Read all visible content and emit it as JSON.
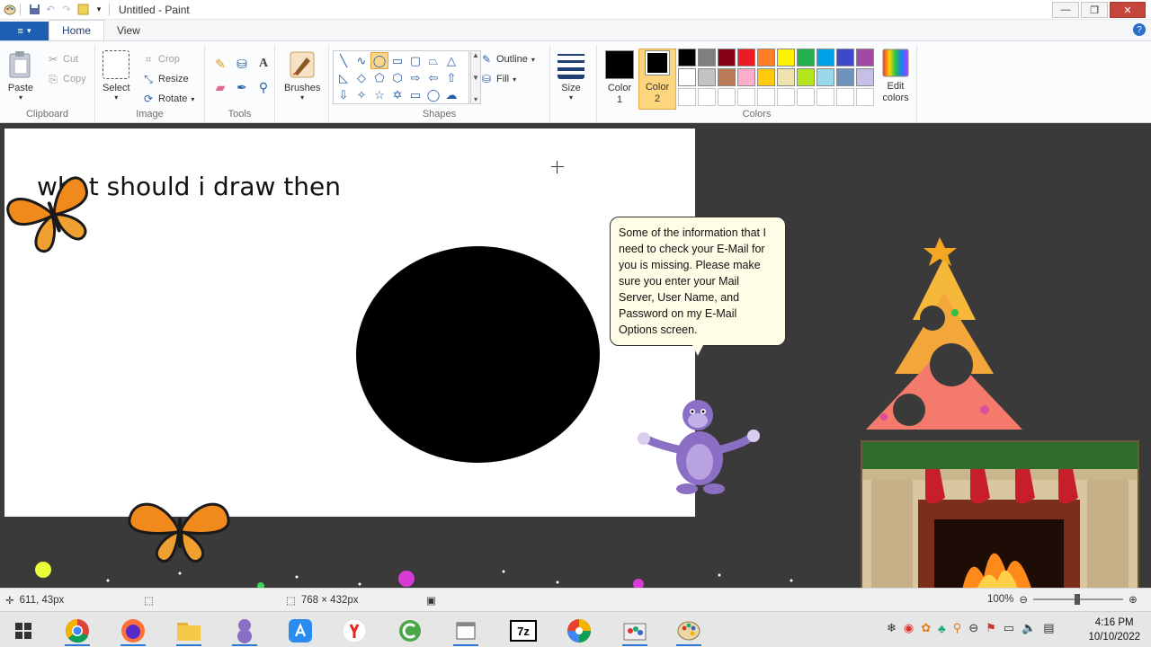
{
  "window": {
    "title": "Untitled - Paint",
    "minimize": "—",
    "restore": "❐",
    "close": "✕"
  },
  "tabs": {
    "file_icon": "≡",
    "home": "Home",
    "view": "View",
    "help": "?"
  },
  "ribbon": {
    "clipboard": {
      "label": "Clipboard",
      "paste": "Paste",
      "cut": "Cut",
      "copy": "Copy"
    },
    "image": {
      "label": "Image",
      "select": "Select",
      "crop": "Crop",
      "resize": "Resize",
      "rotate": "Rotate"
    },
    "tools": {
      "label": "Tools"
    },
    "brushes": {
      "label": "Brushes"
    },
    "shapes": {
      "label": "Shapes",
      "outline": "Outline",
      "fill": "Fill"
    },
    "size": {
      "label": "Size"
    },
    "colors": {
      "label": "Colors",
      "color1": "Color 1",
      "color2": "Color 2",
      "edit": "Edit colors",
      "color1_value": "#000000",
      "color2_value": "#000000",
      "palette_row1": [
        "#000000",
        "#7f7f7f",
        "#880015",
        "#ed1c24",
        "#ff7f27",
        "#fff200",
        "#22b14c",
        "#00a2e8",
        "#3f48cc",
        "#a349a4"
      ],
      "palette_row2": [
        "#ffffff",
        "#c3c3c3",
        "#b97a57",
        "#ffaec9",
        "#ffc90e",
        "#efe4b0",
        "#b5e61d",
        "#99d9ea",
        "#7092be",
        "#c8bfe7"
      ]
    }
  },
  "canvas": {
    "text": "what should i draw then"
  },
  "bubble": {
    "text": "Some of the information that I need to check your E-Mail for you is missing. Please make sure you enter your Mail Server, User Name, and Password on my E-Mail Options screen."
  },
  "status": {
    "cursor": "611, 43px",
    "canvas_size": "768 × 432px",
    "zoom": "100%"
  },
  "taskbar": {
    "time": "4:16 PM",
    "date": "10/10/2022",
    "apps": [
      "start",
      "chrome",
      "firefox",
      "file-explorer",
      "bonzi",
      "app-store",
      "yandex",
      "ccleaner",
      "explorer-window",
      "7zip",
      "picasa",
      "paint-app-1",
      "paint-app-2"
    ]
  }
}
